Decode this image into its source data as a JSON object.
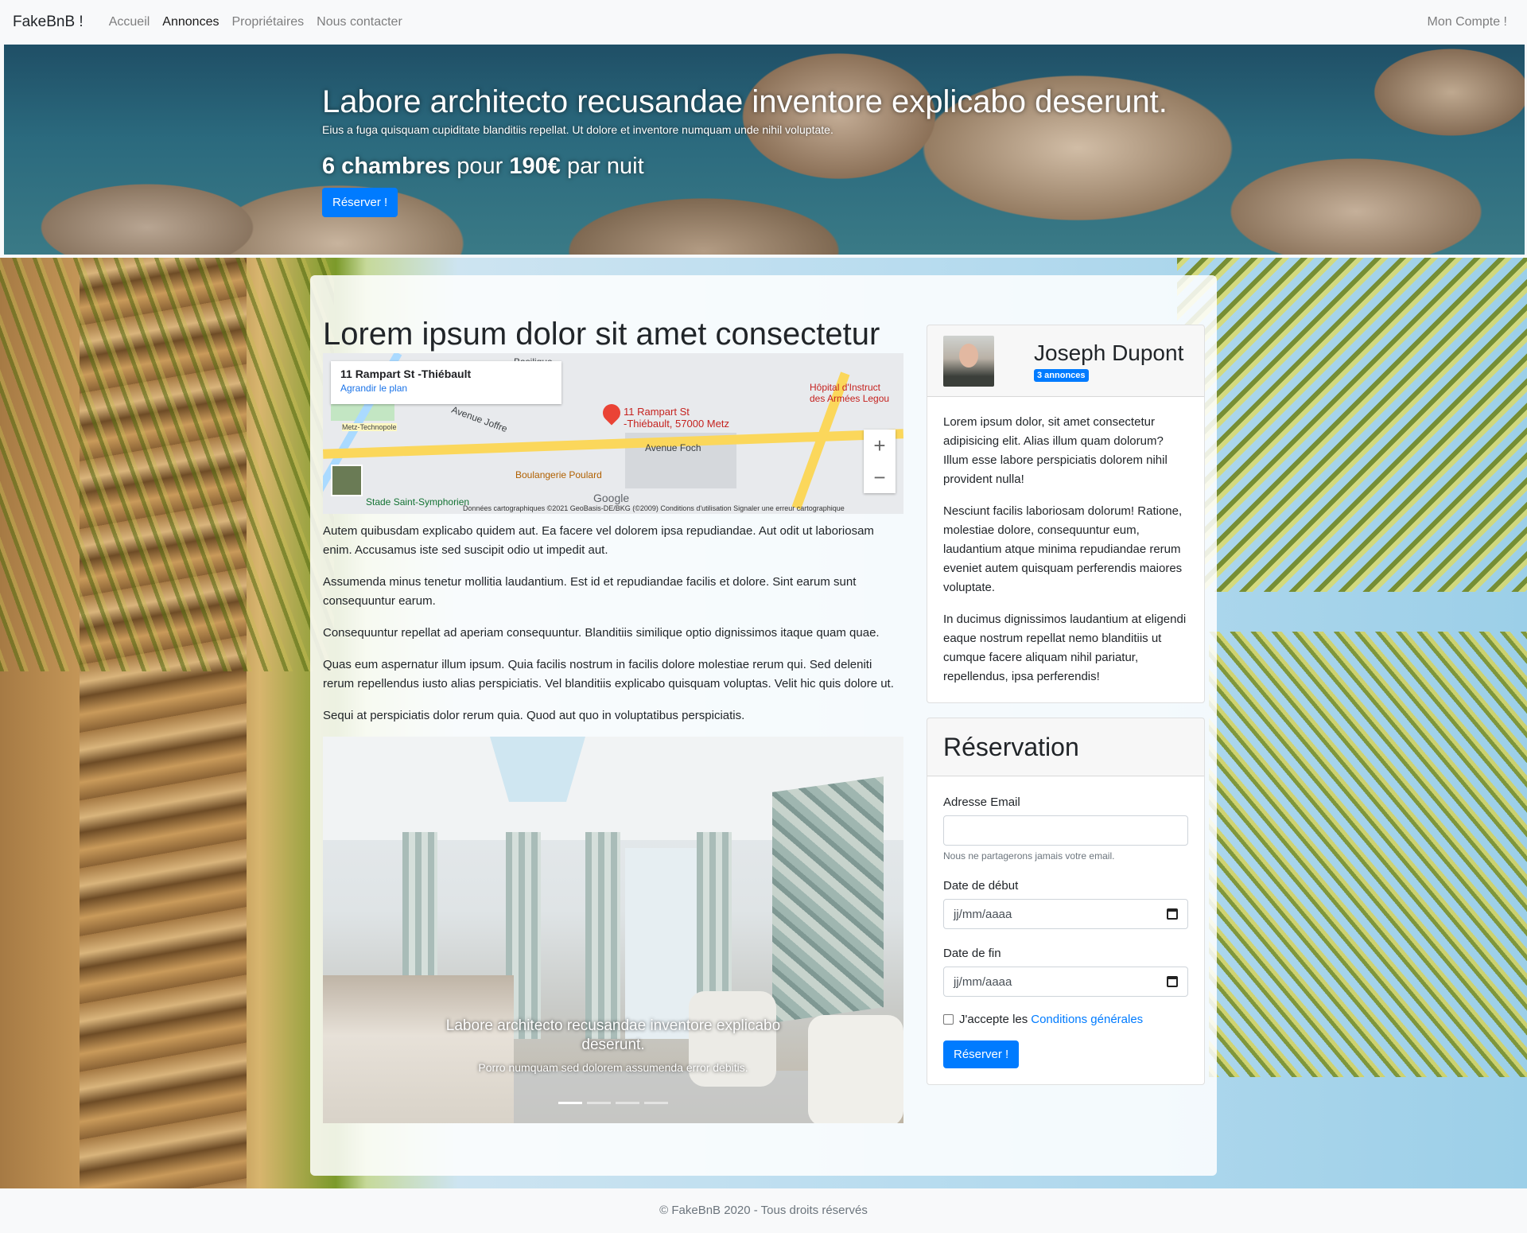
{
  "nav": {
    "brand": "FakeBnB !",
    "links": [
      "Accueil",
      "Annonces",
      "Propriétaires",
      "Nous contacter"
    ],
    "account": "Mon Compte !"
  },
  "hero": {
    "title": "Labore architecto recusandae inventore explicabo deserunt.",
    "subtitle": "Eius a fuga quisquam cupiditate blanditiis repellat. Ut dolore et inventore numquam unde nihil voluptate.",
    "price_rooms": "6 chambres",
    "price_middle": "pour",
    "price_amount": "190€",
    "price_suffix": "par nuit",
    "button": "Réserver !"
  },
  "listing": {
    "title": "Lorem ipsum dolor sit amet consectetur",
    "map": {
      "card_title": "11 Rampart St -Thiébault",
      "card_link": "Agrandir le plan",
      "pin_label_1": "11 Rampart St",
      "pin_label_2": "-Thiébault, 57000 Metz",
      "street_foch": "Avenue Foch",
      "street_joffre": "Avenue Joffre",
      "poi_bakery": "Boulangerie Poulard",
      "poi_stade": "Stade Saint-Symphorien",
      "poi_hospital": "Hôpital d'Instruct des Armées Legou",
      "poi_basilique": "Basilique",
      "poi_technopole": "Metz-Technopole",
      "google": "Google",
      "attribution": "Données cartographiques ©2021 GeoBasis-DE/BKG (©2009)   Conditions d'utilisation   Signaler une erreur cartographique"
    },
    "paragraphs": [
      "Autem quibusdam explicabo quidem aut. Ea facere vel dolorem ipsa repudiandae. Aut odit ut laboriosam enim. Accusamus iste sed suscipit odio ut impedit aut.",
      "Assumenda minus tenetur mollitia laudantium. Est id et repudiandae facilis et dolore. Sint earum sunt consequuntur earum.",
      "Consequuntur repellat ad aperiam consequuntur. Blanditiis similique optio dignissimos itaque quam quae.",
      "Quas eum aspernatur illum ipsum. Quia facilis nostrum in facilis dolore molestiae rerum qui. Sed deleniti rerum repellendus iusto alias perspiciatis. Vel blanditiis explicabo quisquam voluptas. Velit hic quis dolore ut.",
      "Sequi at perspiciatis dolor rerum quia. Quod aut quo in voluptatibus perspiciatis."
    ],
    "carousel": {
      "caption_title": "Labore architecto recusandae inventore explicabo deserunt.",
      "caption_text": "Porro numquam sed dolorem assumenda error debitis.",
      "slides": 4,
      "active_slide": 1
    }
  },
  "owner": {
    "name": "Joseph Dupont",
    "badge": "3 annonces",
    "bio": [
      "Lorem ipsum dolor, sit amet consectetur adipisicing elit. Alias illum quam dolorum? Illum esse labore perspiciatis dolorem nihil provident nulla!",
      "Nesciunt facilis laboriosam dolorum! Ratione, molestiae dolore, consequuntur eum, laudantium atque minima repudiandae rerum eveniet autem quisquam perferendis maiores voluptate.",
      "In ducimus dignissimos laudantium at eligendi eaque nostrum repellat nemo blanditiis ut cumque facere aliquam nihil pariatur, repellendus, ipsa perferendis!"
    ]
  },
  "reservation": {
    "title": "Réservation",
    "email_label": "Adresse Email",
    "email_value": "",
    "email_help": "Nous ne partagerons jamais votre email.",
    "start_label": "Date de début",
    "start_placeholder": "jj/mm/aaaa",
    "end_label": "Date de fin",
    "end_placeholder": "jj/mm/aaaa",
    "terms_prefix": "J'accepte les",
    "terms_link": "Conditions générales",
    "button": "Réserver !"
  },
  "footer": {
    "text": "© FakeBnB 2020 - Tous droits réservés"
  },
  "colors": {
    "primary": "#007bff",
    "navbar_bg": "#f8f9fa"
  }
}
